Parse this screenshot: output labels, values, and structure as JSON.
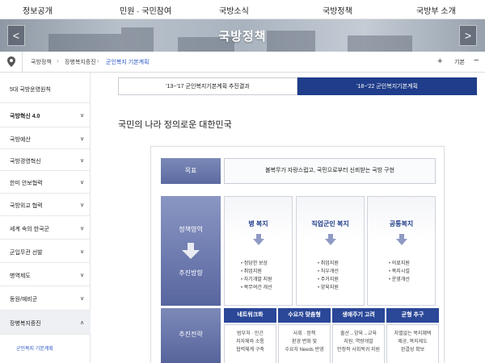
{
  "topnav": [
    "정보공개",
    "민원 · 국민참여",
    "국방소식",
    "국방정책",
    "국방부 소개"
  ],
  "banner": {
    "title": "국방정책",
    "prev_label": "<",
    "next_label": ">"
  },
  "breadcrumb": {
    "items": [
      "국방정책",
      "장병복지증진",
      "군인복지 기본계획"
    ],
    "zoom_in": "+",
    "zoom_label": "기본",
    "zoom_out": "−"
  },
  "sidebar": {
    "items": [
      {
        "label": "5대 국방운영원칙",
        "chevron": ""
      },
      {
        "label": "국방혁신 4.0",
        "chevron": "∨"
      },
      {
        "label": "국방예산",
        "chevron": "∨"
      },
      {
        "label": "국방경영혁신",
        "chevron": "∨"
      },
      {
        "label": "한미 안보협력",
        "chevron": "∨"
      },
      {
        "label": "국방외교 협력",
        "chevron": "∨"
      },
      {
        "label": "세계 속의 한국군",
        "chevron": "∨"
      },
      {
        "label": "군입무관 선발",
        "chevron": "∨"
      },
      {
        "label": "병역제도",
        "chevron": "∨"
      },
      {
        "label": "동원/예비군",
        "chevron": "∨"
      },
      {
        "label": "장병복지증진",
        "chevron": "∧"
      }
    ],
    "sub_items": [
      "군인복지 기본계획"
    ]
  },
  "tabs": [
    "'13~'17 군인복지기본계획 추진결과",
    "'18~'22 군인복지기본계획"
  ],
  "page_title": "국민의 나라 정의로운 대한민국",
  "diagram": {
    "goal_label": "목표",
    "goal_text": "볼복무가 자랑스럽고, 국민으로부터 신뢰받는 국방 구현",
    "policy_label": "정책영역",
    "direction_label": "추진방향",
    "strategy_label": "추진전략",
    "policies": [
      {
        "title": "병 복지",
        "items": [
          "정당한 보상",
          "취업지원",
          "자기개발 지원",
          "복무여건 개선"
        ]
      },
      {
        "title": "직업군인 복지",
        "items": [
          "취업지원",
          "처우개선",
          "주거지원",
          "양육지원"
        ]
      },
      {
        "title": "공통복지",
        "items": [
          "의료지원",
          "복지시설",
          "운영개선"
        ]
      }
    ],
    "strategies": [
      {
        "title": "네트워크화",
        "lines": [
          "범부처 · 민간",
          "지자체와 소통",
          "협력체계 구축"
        ]
      },
      {
        "title": "수요자 맞춤형",
        "lines": [
          "사회 · 정책",
          "환경 변화 및",
          "수요자 Needs 반영"
        ]
      },
      {
        "title": "생애주기 고려",
        "lines": [
          "출산→양육→교육",
          "지원, 역량개발",
          "안정적 사회복귀 지원"
        ]
      },
      {
        "title": "균형 추구",
        "lines": [
          "차별없는 복지혜택",
          "제공, 복지제도",
          "완결성 확보"
        ]
      }
    ]
  }
}
